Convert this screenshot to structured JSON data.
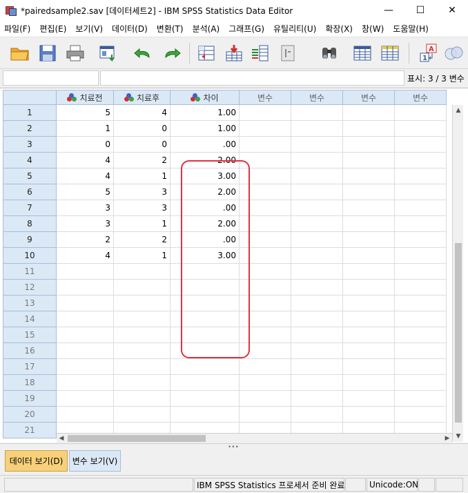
{
  "window": {
    "title": "*pairedsample2.sav [데이터세트2] - IBM SPSS Statistics Data Editor",
    "minimize": "—",
    "maximize": "☐",
    "close": "✕"
  },
  "menu": [
    "파일(F)",
    "편집(E)",
    "보기(V)",
    "데이터(D)",
    "변환(T)",
    "분석(A)",
    "그래프(G)",
    "유틸리티(U)",
    "확장(X)",
    "창(W)",
    "도움말(H)"
  ],
  "toolbar": {
    "icons": [
      "open-folder-icon",
      "save-icon",
      "print-icon",
      "dialog-recall-icon",
      "undo-icon",
      "redo-icon",
      "goto-case-icon",
      "goto-variable-icon",
      "variables-icon",
      "run-descriptives-icon",
      "find-icon",
      "insert-cases-icon",
      "insert-variable-icon",
      "split-file-icon",
      "weight-cases-icon",
      "select-cases-icon",
      "value-labels-icon",
      "use-variable-sets-icon"
    ]
  },
  "editor": {
    "cell_name": "",
    "cell_value": "",
    "visible_label": "표시: 3 / 3 변수"
  },
  "grid": {
    "columns": [
      "치료전",
      "치료후",
      "차이",
      "변수",
      "변수",
      "변수",
      "변수"
    ],
    "rows": [
      [
        "5",
        "4",
        "1.00"
      ],
      [
        "1",
        "0",
        "1.00"
      ],
      [
        "0",
        "0",
        ".00"
      ],
      [
        "4",
        "2",
        "2.00"
      ],
      [
        "4",
        "1",
        "3.00"
      ],
      [
        "5",
        "3",
        "2.00"
      ],
      [
        "3",
        "3",
        ".00"
      ],
      [
        "3",
        "1",
        "2.00"
      ],
      [
        "2",
        "2",
        ".00"
      ],
      [
        "4",
        "1",
        "3.00"
      ]
    ],
    "row_numbers": [
      "1",
      "2",
      "3",
      "4",
      "5",
      "6",
      "7",
      "8",
      "9",
      "10",
      "11",
      "12",
      "13",
      "14",
      "15",
      "16",
      "17",
      "18",
      "19",
      "20",
      "21"
    ],
    "highlight_color": "#e03040"
  },
  "tabs": {
    "data_view": "데이터 보기(D)",
    "variable_view": "변수 보기(V)"
  },
  "status": {
    "processor": "IBM SPSS Statistics 프로세서 준비 완료",
    "unicode": "Unicode:ON"
  }
}
